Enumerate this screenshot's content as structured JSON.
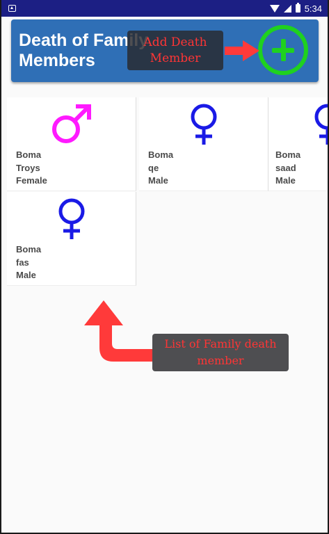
{
  "status_bar": {
    "time": "5:34",
    "icons": [
      "notification-icon",
      "wifi-icon",
      "signal-icon",
      "battery-icon"
    ]
  },
  "header": {
    "title": "Death of Family Members",
    "add_icon": "add-circle-icon"
  },
  "annotations": {
    "add_callout": "Add Death Member",
    "list_callout": "List of Family death member"
  },
  "members": [
    {
      "name": "Boma",
      "relation": "Troys",
      "gender": "Female",
      "icon": "male-symbol-icon"
    },
    {
      "name": "Boma",
      "relation": "qe",
      "gender": "Male",
      "icon": "female-symbol-icon"
    },
    {
      "name": "Boma",
      "relation": "saad",
      "gender": "Male",
      "icon": "female-symbol-icon"
    },
    {
      "name": "Boma",
      "relation": "fas",
      "gender": "Male",
      "icon": "female-symbol-icon"
    }
  ],
  "colors": {
    "status_bar": "#1c1f84",
    "header": "#2f6fb6",
    "add_button": "#1fd11f",
    "male_symbol": "#ff1aff",
    "female_symbol": "#1a1ae6",
    "callout_text": "#ff3535"
  }
}
